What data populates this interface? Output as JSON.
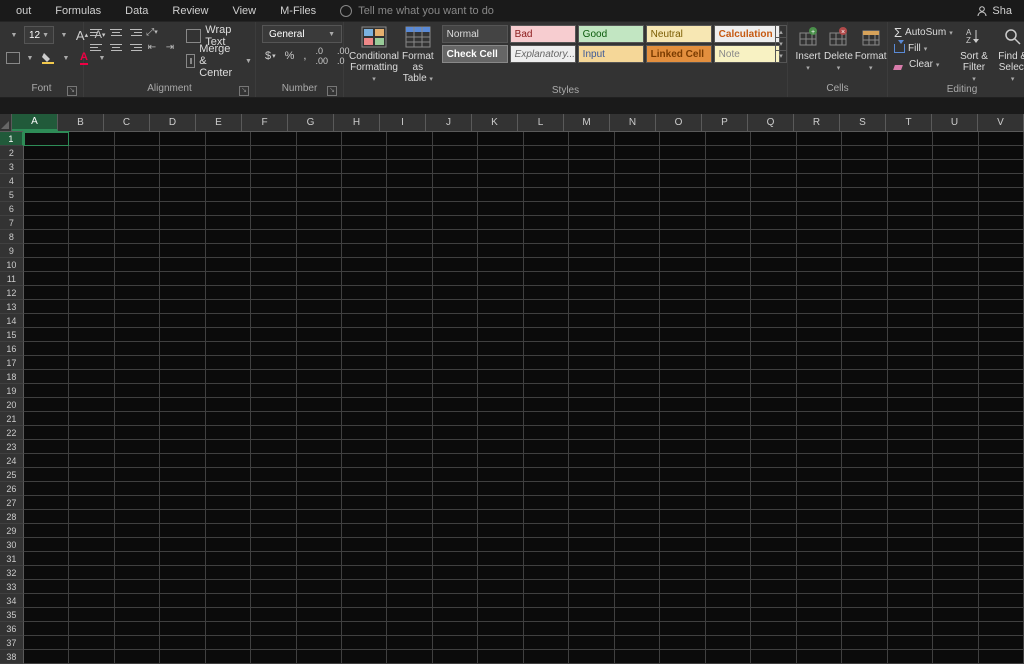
{
  "menu": {
    "tabs": [
      "out",
      "Formulas",
      "Data",
      "Review",
      "View",
      "M-Files"
    ],
    "tellme": "Tell me what you want to do",
    "share": "Sha"
  },
  "ribbon": {
    "font": {
      "size": "12",
      "group_label": "Font"
    },
    "alignment": {
      "wrap": "Wrap Text",
      "merge": "Merge & Center",
      "group_label": "Alignment"
    },
    "number": {
      "format": "General",
      "dollar": "$",
      "percent": "%",
      "comma": ",",
      "group_label": "Number"
    },
    "cond_fmt": "Conditional\nFormatting",
    "fmt_table": "Format as\nTable",
    "styles": {
      "row1": [
        {
          "label": "Normal",
          "cls": "sc-normal"
        },
        {
          "label": "Bad",
          "cls": "sc-bad"
        },
        {
          "label": "Good",
          "cls": "sc-good"
        },
        {
          "label": "Neutral",
          "cls": "sc-neutral"
        },
        {
          "label": "Calculation",
          "cls": "sc-calc"
        }
      ],
      "row2": [
        {
          "label": "Check Cell",
          "cls": "sc-check"
        },
        {
          "label": "Explanatory...",
          "cls": "sc-explan"
        },
        {
          "label": "Input",
          "cls": "sc-input"
        },
        {
          "label": "Linked Cell",
          "cls": "sc-linked"
        },
        {
          "label": "Note",
          "cls": "sc-note"
        }
      ],
      "group_label": "Styles"
    },
    "cells": {
      "insert": "Insert",
      "delete": "Delete",
      "format": "Format",
      "group_label": "Cells"
    },
    "editing": {
      "autosum": "AutoSum",
      "fill": "Fill",
      "clear": "Clear",
      "sort": "Sort &\nFilter",
      "find": "Find &\nSelect",
      "group_label": "Editing"
    }
  },
  "grid": {
    "columns": [
      "A",
      "B",
      "C",
      "D",
      "E",
      "F",
      "G",
      "H",
      "I",
      "J",
      "K",
      "L",
      "M",
      "N",
      "O",
      "P",
      "Q",
      "R",
      "S",
      "T",
      "U",
      "V"
    ],
    "rows": 38,
    "selected_cell": {
      "col": "A",
      "row": 1
    }
  }
}
